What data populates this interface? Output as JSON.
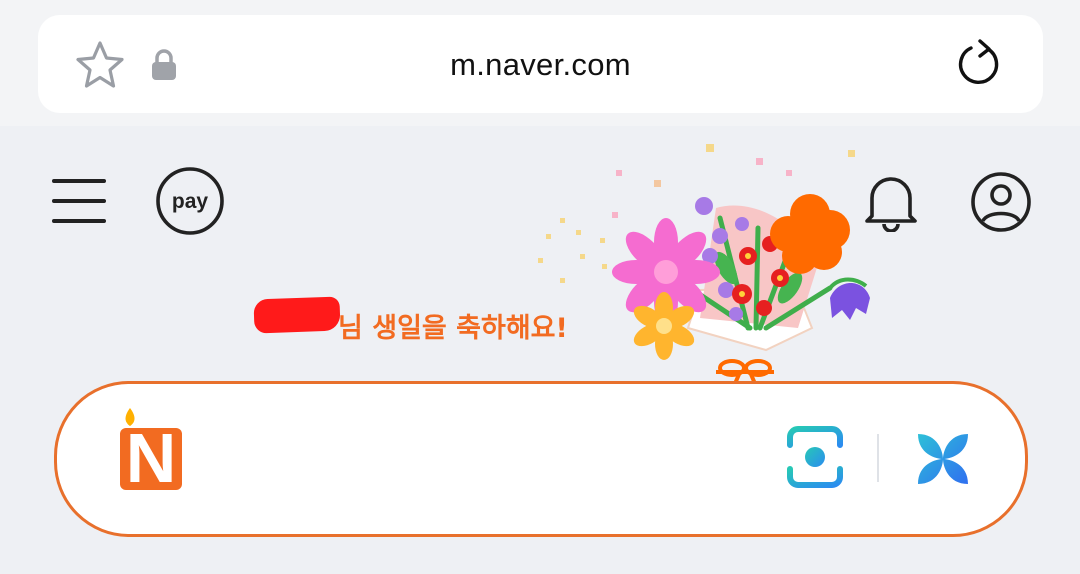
{
  "browser": {
    "url": "m.naver.com",
    "icons": [
      "star-icon",
      "lock-icon",
      "reload-icon"
    ]
  },
  "header": {
    "menu_icon": "hamburger-menu-icon",
    "pay_label": "pay",
    "notification_icon": "bell-icon",
    "profile_icon": "user-profile-icon"
  },
  "banner": {
    "birthday_text": "님 생일을 축하해요!",
    "accent_color": "#f26b21"
  },
  "search": {
    "logo_text": "N",
    "border_color": "#e8702c",
    "icons": [
      "lens-camera-icon",
      "ai-search-icon"
    ]
  }
}
